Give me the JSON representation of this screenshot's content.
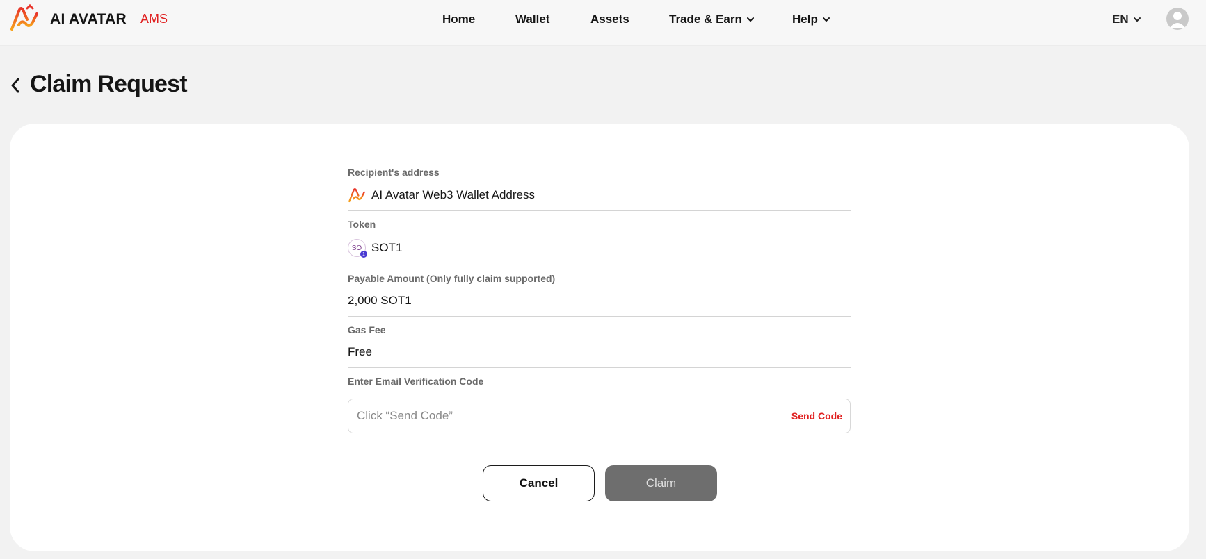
{
  "header": {
    "brand": "AI AVATAR",
    "brand_tag": "AMS",
    "nav": [
      {
        "label": "Home",
        "dropdown": false
      },
      {
        "label": "Wallet",
        "dropdown": false
      },
      {
        "label": "Assets",
        "dropdown": false
      },
      {
        "label": "Trade & Earn",
        "dropdown": true
      },
      {
        "label": "Help",
        "dropdown": true
      }
    ],
    "language": "EN",
    "icons": {
      "logo": "ai-avatar-logo-icon",
      "avatar": "user-avatar-icon",
      "chevron": "chevron-down-icon"
    }
  },
  "page": {
    "title": "Claim Request",
    "back_icon": "chevron-left-icon"
  },
  "form": {
    "recipient": {
      "label": "Recipient's address",
      "value": "AI Avatar Web3 Wallet Address",
      "icon": "ai-avatar-logo-icon"
    },
    "token": {
      "label": "Token",
      "value": "SOT1",
      "icon_text": "SO",
      "icon_badge": "1",
      "icon": "sot1-token-icon"
    },
    "amount": {
      "label": "Payable Amount (Only fully claim supported)",
      "value": "2,000 SOT1"
    },
    "gas_fee": {
      "label": "Gas Fee",
      "value": "Free"
    },
    "verification": {
      "label": "Enter Email Verification Code",
      "placeholder": "Click “Send Code”",
      "value": "",
      "send_label": "Send Code"
    }
  },
  "actions": {
    "cancel_label": "Cancel",
    "claim_label": "Claim",
    "claim_enabled": false
  },
  "colors": {
    "accent": "#e02020",
    "logo_gradient_top": "#e8342a",
    "logo_gradient_bottom": "#f7a21b",
    "claim_disabled_bg": "#6e6e6e",
    "page_bg": "#f2f2f2"
  }
}
